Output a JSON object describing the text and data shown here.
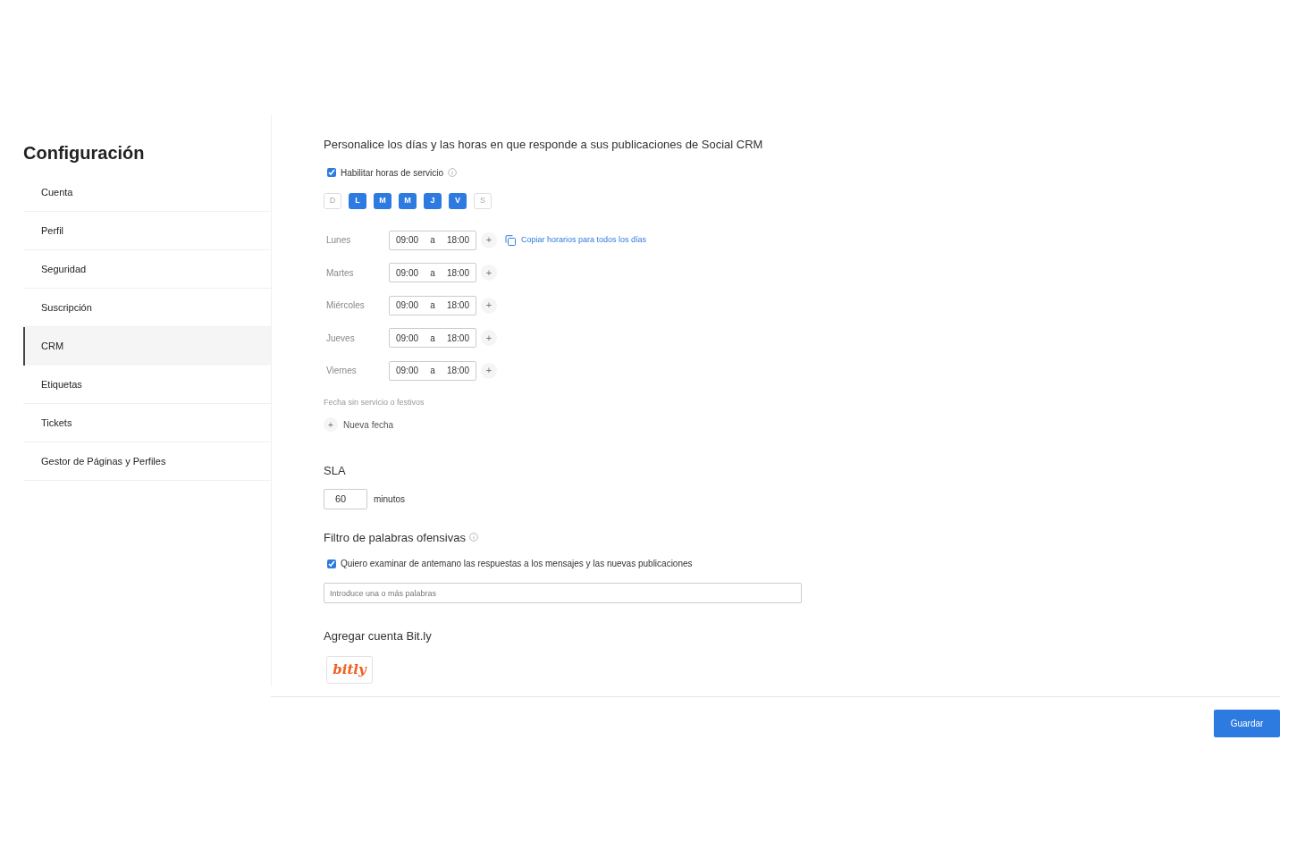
{
  "sidebar": {
    "title": "Configuración",
    "items": [
      {
        "label": "Cuenta",
        "selected": false
      },
      {
        "label": "Perfil",
        "selected": false
      },
      {
        "label": "Seguridad",
        "selected": false
      },
      {
        "label": "Suscripción",
        "selected": false
      },
      {
        "label": "CRM",
        "selected": true
      },
      {
        "label": "Etiquetas",
        "selected": false
      },
      {
        "label": "Tickets",
        "selected": false
      },
      {
        "label": "Gestor de Páginas y Perfiles",
        "selected": false
      }
    ]
  },
  "service_hours": {
    "heading": "Personalice los días y las horas en que responde a sus publicaciones de Social CRM",
    "enable": {
      "label": "Habilitar horas de servicio",
      "checked": true
    },
    "days": [
      {
        "label": "D",
        "selected": false
      },
      {
        "label": "L",
        "selected": true
      },
      {
        "label": "M",
        "selected": true
      },
      {
        "label": "M",
        "selected": true
      },
      {
        "label": "J",
        "selected": true
      },
      {
        "label": "V",
        "selected": true
      },
      {
        "label": "S",
        "selected": false
      }
    ],
    "schedule": [
      {
        "day": "Lunes",
        "from": "09:00",
        "separator": "a",
        "to": "18:00",
        "add": "+",
        "copy_link": "Copiar horarios para todos los días"
      },
      {
        "day": "Martes",
        "from": "09:00",
        "separator": "a",
        "to": "18:00",
        "add": "+"
      },
      {
        "day": "Miércoles",
        "from": "09:00",
        "separator": "a",
        "to": "18:00",
        "add": "+"
      },
      {
        "day": "Jueves",
        "from": "09:00",
        "separator": "a",
        "to": "18:00",
        "add": "+"
      },
      {
        "day": "Viernes",
        "from": "09:00",
        "separator": "a",
        "to": "18:00",
        "add": "+"
      }
    ],
    "holidays_label": "Fecha sin servicio o festivos",
    "new_date": {
      "icon": "+",
      "label": "Nueva fecha"
    }
  },
  "sla": {
    "heading": "SLA",
    "value": "60",
    "unit": "minutos"
  },
  "filter": {
    "heading": "Filtro de palabras ofensivas",
    "check": {
      "label": "Quiero examinar de antemano las respuestas a los mensajes y las nuevas publicaciones",
      "checked": true
    },
    "placeholder": "Introduce una o más palabras"
  },
  "bitly": {
    "heading": "Agregar cuenta Bit.ly",
    "logo": "bitly"
  },
  "save_button": "Guardar"
}
